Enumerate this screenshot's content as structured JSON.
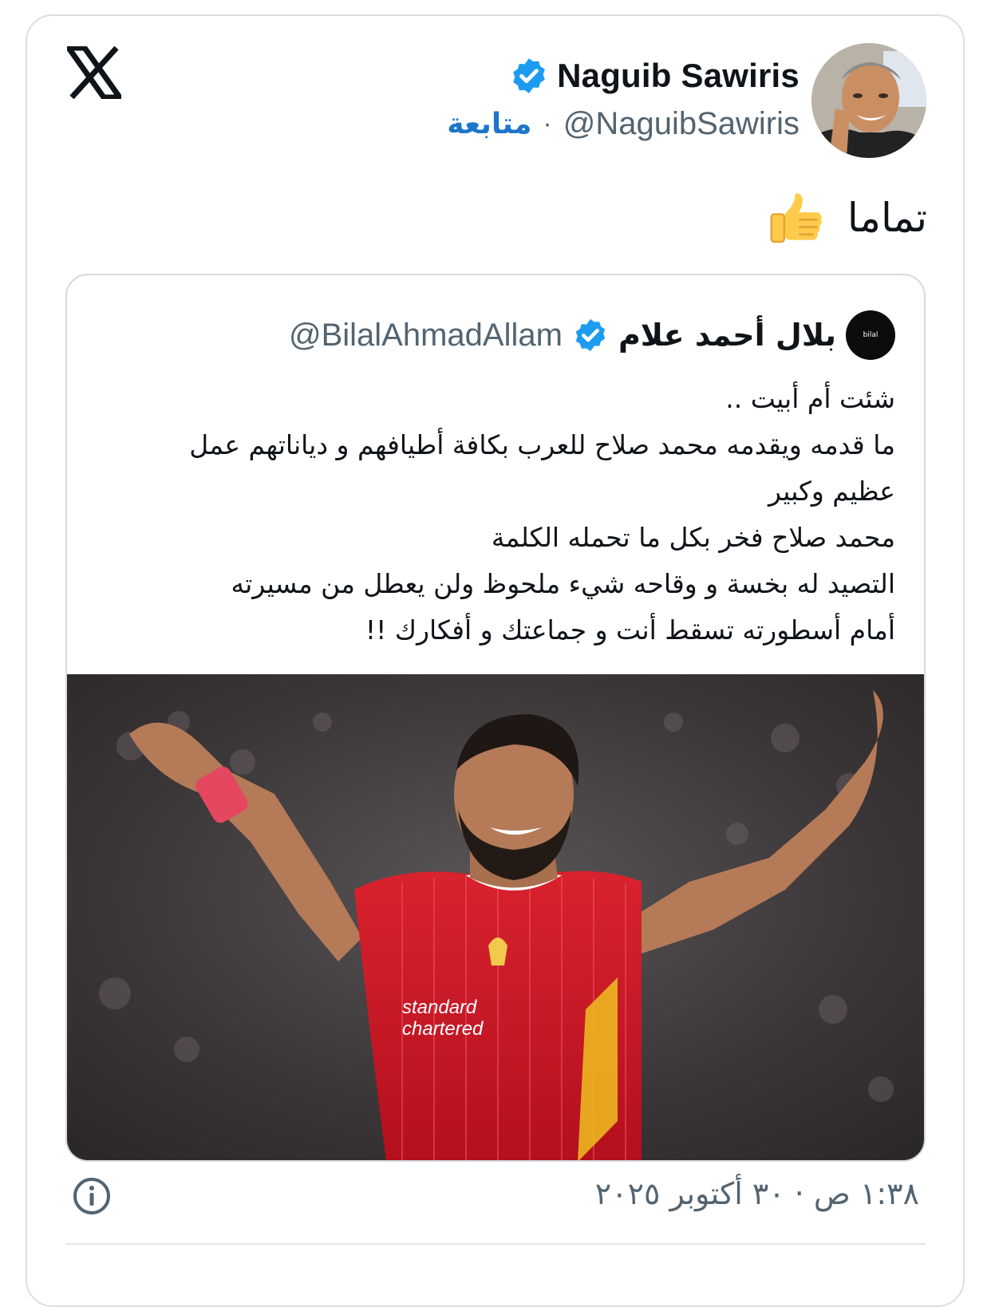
{
  "author": {
    "display_name": "Naguib Sawiris",
    "handle": "@NaguibSawiris",
    "follow_label": "متابعة",
    "separator": "·",
    "avatar": "profile-photo"
  },
  "tweet": {
    "text": "تماما",
    "emoji": "thumbs-up-icon"
  },
  "quoted_tweet": {
    "display_name": "بلال أحمد علام",
    "handle": "@BilalAhmadAllam",
    "lines": [
      "شئت أم أبيت ..",
      "ما قدمه ويقدمه محمد صلاح للعرب بكافة أطيافهم و دياناتهم عمل",
      "عظيم وكبير",
      "محمد صلاح فخر بكل ما تحمله الكلمة",
      "التصيد له بخسة و وقاحه شيء ملحوظ ولن يعطل من مسيرته",
      "أمام أسطورته تسقط أنت و جماعتك و أفكارك !!"
    ],
    "image_text": "standard chartered"
  },
  "footer": {
    "timestamp": "١:٣٨ ص · ٣٠ أكتوبر ٢٠٢٥"
  },
  "colors": {
    "verified_blue": "#1d9bf0",
    "link_blue": "#1d76c9",
    "secondary_text": "#536471",
    "jersey_red": "#c8102e"
  }
}
